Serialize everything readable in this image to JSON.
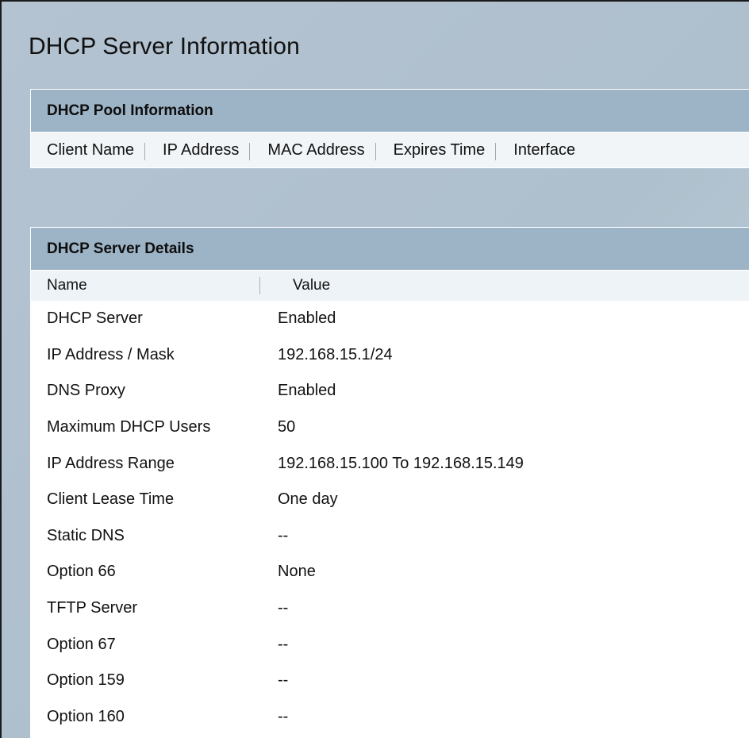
{
  "page": {
    "title": "DHCP Server Information"
  },
  "pool": {
    "header": "DHCP Pool Information",
    "columns": [
      "Client Name",
      "IP Address",
      "MAC Address",
      "Expires Time",
      "Interface"
    ]
  },
  "details": {
    "header": "DHCP Server Details",
    "columns": {
      "name": "Name",
      "value": "Value"
    },
    "rows": [
      {
        "name": "DHCP Server",
        "value": "Enabled"
      },
      {
        "name": "IP Address / Mask",
        "value": "192.168.15.1/24"
      },
      {
        "name": "DNS Proxy",
        "value": "Enabled"
      },
      {
        "name": "Maximum DHCP Users",
        "value": "50"
      },
      {
        "name": "IP Address Range",
        "value": "192.168.15.100 To 192.168.15.149"
      },
      {
        "name": "Client Lease Time",
        "value": "One day"
      },
      {
        "name": "Static DNS",
        "value": "--"
      },
      {
        "name": "Option 66",
        "value": "None"
      },
      {
        "name": "TFTP Server",
        "value": "--"
      },
      {
        "name": "Option 67",
        "value": "--"
      },
      {
        "name": "Option 159",
        "value": "--"
      },
      {
        "name": "Option 160",
        "value": "--"
      }
    ]
  }
}
